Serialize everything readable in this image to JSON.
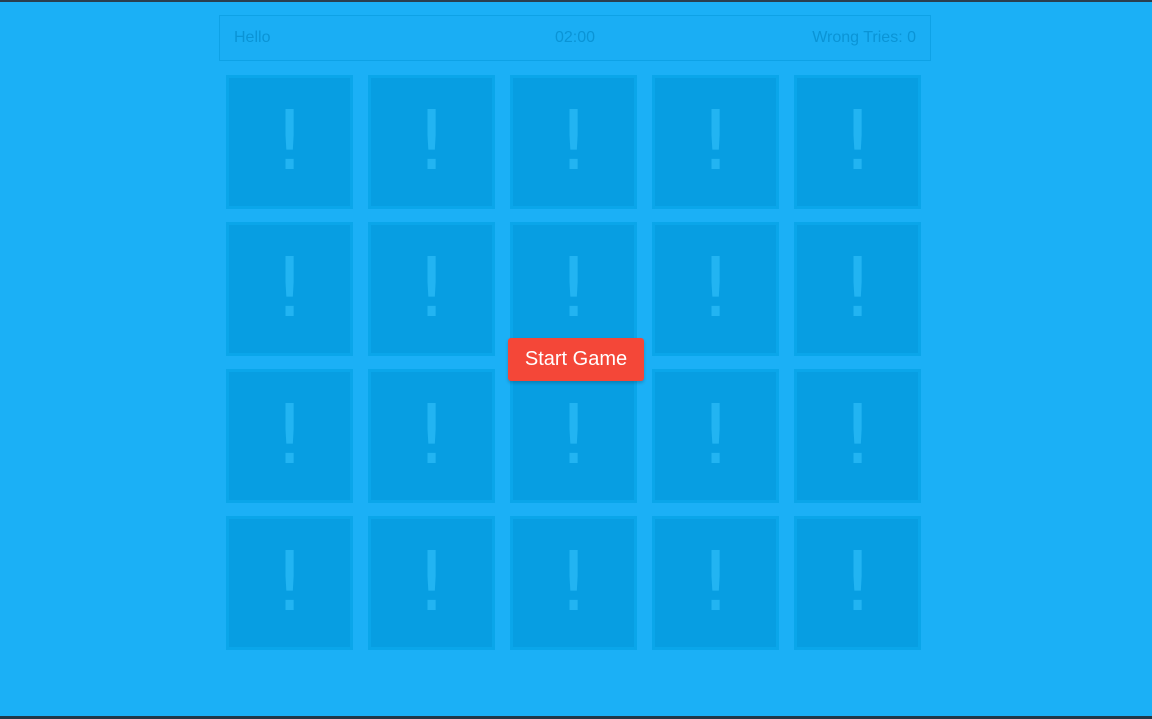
{
  "hud": {
    "greeting": "Hello",
    "timer": "02:00",
    "wrong_tries": "Wrong Tries: 0"
  },
  "cards": [
    {
      "face": "!"
    },
    {
      "face": "!"
    },
    {
      "face": "!"
    },
    {
      "face": "!"
    },
    {
      "face": "!"
    },
    {
      "face": "!"
    },
    {
      "face": "!"
    },
    {
      "face": "!"
    },
    {
      "face": "!"
    },
    {
      "face": "!"
    },
    {
      "face": "!"
    },
    {
      "face": "!"
    },
    {
      "face": "!"
    },
    {
      "face": "!"
    },
    {
      "face": "!"
    },
    {
      "face": "!"
    },
    {
      "face": "!"
    },
    {
      "face": "!"
    },
    {
      "face": "!"
    },
    {
      "face": "!"
    }
  ],
  "start_button": {
    "label": "Start Game"
  },
  "colors": {
    "background": "#1bb0f6",
    "card": "#079ee2",
    "button": "#f44738"
  }
}
